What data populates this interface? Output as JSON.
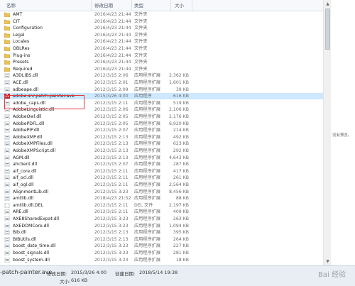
{
  "columns": {
    "name": "名称",
    "modified": "修改日期",
    "type": "类型",
    "size": "大小"
  },
  "files": [
    {
      "name": "AMT",
      "date": "2016/4/23 21:44",
      "type": "文件夹",
      "size": "",
      "kind": "folder"
    },
    {
      "name": "CIT",
      "date": "2016/4/23 21:44",
      "type": "文件夹",
      "size": "",
      "kind": "folder"
    },
    {
      "name": "Configuration",
      "date": "2016/4/23 21:44",
      "type": "文件夹",
      "size": "",
      "kind": "folder"
    },
    {
      "name": "Legal",
      "date": "2016/4/23 21:44",
      "type": "文件夹",
      "size": "",
      "kind": "folder"
    },
    {
      "name": "Locales",
      "date": "2016/4/23 21:44",
      "type": "文件夹",
      "size": "",
      "kind": "folder"
    },
    {
      "name": "OBLRes",
      "date": "2016/4/23 21:44",
      "type": "文件夹",
      "size": "",
      "kind": "folder"
    },
    {
      "name": "Plug-ins",
      "date": "2016/4/23 21:44",
      "type": "文件夹",
      "size": "",
      "kind": "folder"
    },
    {
      "name": "Presets",
      "date": "2016/4/23 21:44",
      "type": "文件夹",
      "size": "",
      "kind": "folder"
    },
    {
      "name": "Required",
      "date": "2016/4/23 21:44",
      "type": "文件夹",
      "size": "",
      "kind": "folder"
    },
    {
      "name": "A3DLIBS.dll",
      "date": "2012/3/15 2:06",
      "type": "应用程序扩展",
      "size": "2,362 KB",
      "kind": "dll"
    },
    {
      "name": "ACE.dll",
      "date": "2012/3/15 2:01",
      "type": "应用程序扩展",
      "size": "1,601 KB",
      "kind": "dll"
    },
    {
      "name": "adbeape.dll",
      "date": "2012/3/15 2:09",
      "type": "应用程序扩展",
      "size": "39 KB",
      "kind": "dll"
    },
    {
      "name": "adobe.snr.patch-painter.ave",
      "date": "2015/3/26 4:00",
      "type": "应用程序",
      "size": "616 KB",
      "kind": "exe",
      "selected": true
    },
    {
      "name": "adobe_caps.dll",
      "date": "2012/3/15 2:11",
      "type": "应用程序扩展",
      "size": "519 KB",
      "kind": "dll"
    },
    {
      "name": "AdobeLinguistic.dll",
      "date": "2012/3/15 2:06",
      "type": "应用程序扩展",
      "size": "2,106 KB",
      "kind": "dll"
    },
    {
      "name": "AdobeOwl.dll",
      "date": "2012/3/15 2:05",
      "type": "应用程序扩展",
      "size": "2,176 KB",
      "kind": "dll"
    },
    {
      "name": "AdobePDFL.dll",
      "date": "2012/3/15 2:05",
      "type": "应用程序扩展",
      "size": "6,920 KB",
      "kind": "dll"
    },
    {
      "name": "AdobePIP.dll",
      "date": "2012/3/15 2:07",
      "type": "应用程序扩展",
      "size": "214 KB",
      "kind": "dll"
    },
    {
      "name": "AdobeXMP.dll",
      "date": "2012/3/15 2:13",
      "type": "应用程序扩展",
      "size": "492 KB",
      "kind": "dll"
    },
    {
      "name": "AdobeXMPFiles.dll",
      "date": "2012/3/15 2:13",
      "type": "应用程序扩展",
      "size": "623 KB",
      "kind": "dll"
    },
    {
      "name": "AdobeXMPScript.dll",
      "date": "2012/3/15 2:13",
      "type": "应用程序扩展",
      "size": "292 KB",
      "kind": "dll"
    },
    {
      "name": "AGM.dll",
      "date": "2012/3/15 2:13",
      "type": "应用程序扩展",
      "size": "4,643 KB",
      "kind": "dll"
    },
    {
      "name": "ahclient.dll",
      "date": "2012/3/15 2:07",
      "type": "应用程序扩展",
      "size": "287 KB",
      "kind": "dll"
    },
    {
      "name": "aif_core.dll",
      "date": "2012/3/15 2:11",
      "type": "应用程序扩展",
      "size": "417 KB",
      "kind": "dll"
    },
    {
      "name": "aif_ocl.dll",
      "date": "2012/3/15 2:11",
      "type": "应用程序扩展",
      "size": "261 KB",
      "kind": "dll"
    },
    {
      "name": "aif_ogl.dll",
      "date": "2012/3/15 2:11",
      "type": "应用程序扩展",
      "size": "2,564 KB",
      "kind": "dll"
    },
    {
      "name": "AlignmentLib.dll",
      "date": "2012/3/15 3:23",
      "type": "应用程序扩展",
      "size": "8,456 KB",
      "kind": "dll"
    },
    {
      "name": "amtlib.dll",
      "date": "2018/4/23 21:52",
      "type": "应用程序扩展",
      "size": "88 KB",
      "kind": "dll"
    },
    {
      "name": "amtlib.dll.DEL",
      "date": "2012/3/15 2:11",
      "type": "DEL 文件",
      "size": "2,197 KB",
      "kind": "file"
    },
    {
      "name": "ARE.dll",
      "date": "2012/3/15 2:11",
      "type": "应用程序扩展",
      "size": "409 KB",
      "kind": "dll"
    },
    {
      "name": "AXE8SharedExpat.dll",
      "date": "2012/3/15 3:23",
      "type": "应用程序扩展",
      "size": "263 KB",
      "kind": "dll"
    },
    {
      "name": "AXEDOMCore.dll",
      "date": "2012/3/15 3:23",
      "type": "应用程序扩展",
      "size": "1,094 KB",
      "kind": "dll"
    },
    {
      "name": "Bib.dll",
      "date": "2012/3/15 2:13",
      "type": "应用程序扩展",
      "size": "395 KB",
      "kind": "dll"
    },
    {
      "name": "BIBUtils.dll",
      "date": "2012/3/15 2:13",
      "type": "应用程序扩展",
      "size": "264 KB",
      "kind": "dll"
    },
    {
      "name": "boost_date_time.dll",
      "date": "2012/3/15 3:23",
      "type": "应用程序扩展",
      "size": "227 KB",
      "kind": "dll"
    },
    {
      "name": "boost_signals.dll",
      "date": "2012/3/15 3:23",
      "type": "应用程序扩展",
      "size": "281 KB",
      "kind": "dll"
    },
    {
      "name": "boost_system.dll",
      "date": "2012/3/15 3:23",
      "type": "应用程序扩展",
      "size": "18 KB",
      "kind": "dll"
    }
  ],
  "side_label": "没有预览。",
  "details": {
    "name": "-patch-painter.ave",
    "modified_label": "修改日期:",
    "modified_value": "2015/3/26 4:00",
    "created_label": "创建日期:",
    "created_value": "2018/5/14 19:38",
    "size_label": "大小:",
    "size_value": "616 KB"
  },
  "watermark": "Bai 经验"
}
